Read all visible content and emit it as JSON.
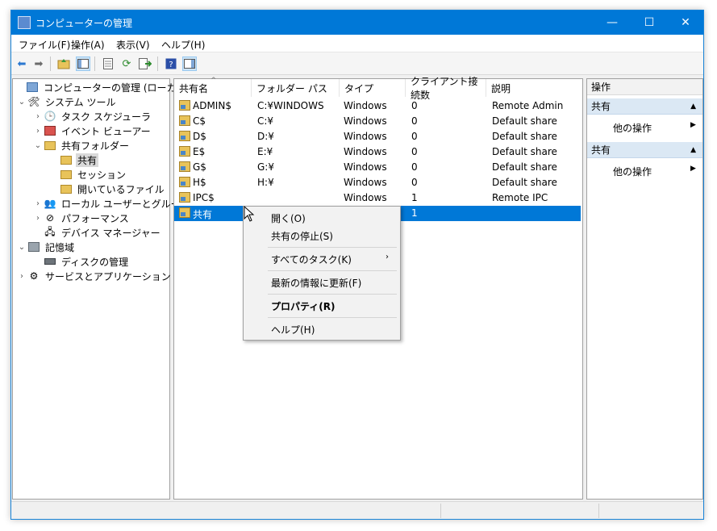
{
  "window": {
    "title": "コンピューターの管理",
    "min_glyph": "—",
    "max_glyph": "☐",
    "close_glyph": "✕"
  },
  "menu": [
    "ファイル(F)",
    "操作(A)",
    "表示(V)",
    "ヘルプ(H)"
  ],
  "tree": {
    "root": "コンピューターの管理 (ローカル)",
    "system_tools": "システム ツール",
    "task_scheduler": "タスク スケジューラ",
    "event_viewer": "イベント ビューアー",
    "shared_folders": "共有フォルダー",
    "shares": "共有",
    "sessions": "セッション",
    "open_files": "開いているファイル",
    "local_users": "ローカル ユーザーとグループ",
    "performance": "パフォーマンス",
    "device_manager": "デバイス マネージャー",
    "storage": "記憶域",
    "disk_management": "ディスクの管理",
    "services_apps": "サービスとアプリケーション"
  },
  "list": {
    "headers": [
      "共有名",
      "フォルダー パス",
      "タイプ",
      "クライアント接続数",
      "説明"
    ],
    "sort_indicator": "^",
    "rows": [
      [
        "ADMIN$",
        "C:¥WINDOWS",
        "Windows",
        "0",
        "Remote Admin"
      ],
      [
        "C$",
        "C:¥",
        "Windows",
        "0",
        "Default share"
      ],
      [
        "D$",
        "D:¥",
        "Windows",
        "0",
        "Default share"
      ],
      [
        "E$",
        "E:¥",
        "Windows",
        "0",
        "Default share"
      ],
      [
        "G$",
        "G:¥",
        "Windows",
        "0",
        "Default share"
      ],
      [
        "H$",
        "H:¥",
        "Windows",
        "0",
        "Default share"
      ],
      [
        "IPC$",
        "",
        "Windows",
        "1",
        "Remote IPC"
      ],
      [
        "共有",
        "",
        "",
        "1",
        ""
      ]
    ]
  },
  "actions": {
    "header": "操作",
    "section1": "共有",
    "section1_item": "他の操作",
    "section2": "共有",
    "section2_item": "他の操作"
  },
  "context_menu": {
    "open": "開く(O)",
    "stop_sharing": "共有の停止(S)",
    "all_tasks": "すべてのタスク(K)",
    "refresh": "最新の情報に更新(F)",
    "properties": "プロパティ(R)",
    "help": "ヘルプ(H)"
  },
  "colors": {
    "accent": "#0078d7",
    "selection": "#0078d7",
    "action_section": "#dbe8f4"
  }
}
